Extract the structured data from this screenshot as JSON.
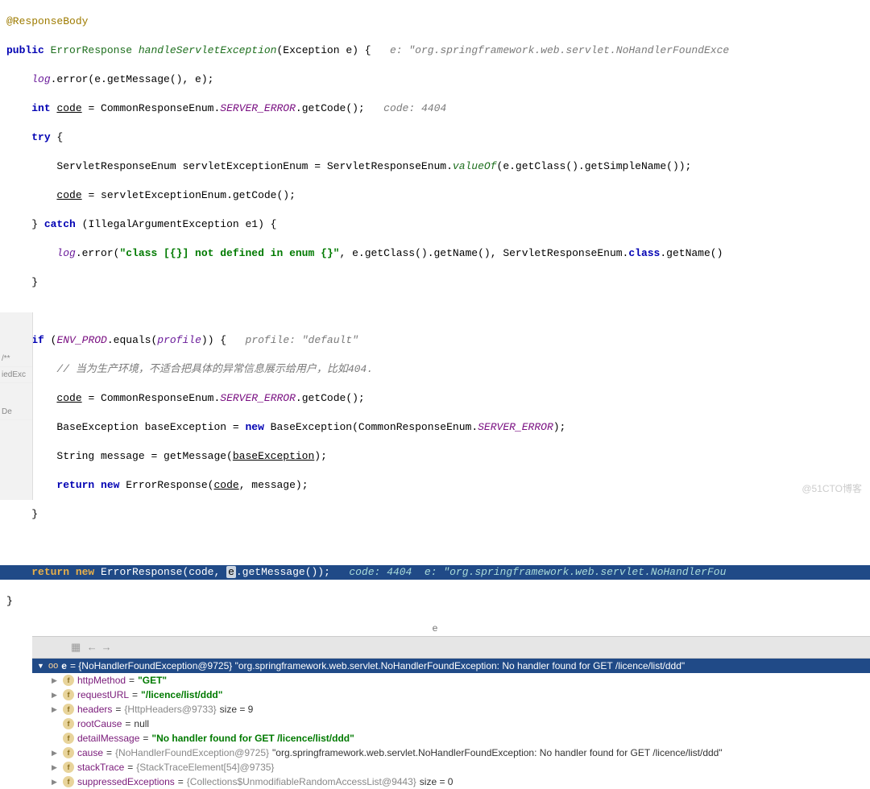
{
  "code": {
    "annotation": "@ResponseBody",
    "l1_public": "public",
    "l1_retType": "ErrorResponse",
    "l1_method": "handleServletException",
    "l1_params": "(Exception e) {",
    "l1_hint": "e: \"org.springframework.web.servlet.NoHandlerFoundExce",
    "l2a": "log",
    "l2b": ".error(e.getMessage(), e);",
    "l3a": "int",
    "l3b": "code",
    "l3c": " = CommonResponseEnum.",
    "l3d": "SERVER_ERROR",
    "l3e": ".getCode();",
    "l3hint": "code: 4404",
    "l4": "try",
    "l4b": " {",
    "l5a": "ServletResponseEnum servletExceptionEnum = ServletResponseEnum.",
    "l5b": "valueOf",
    "l5c": "(e.getClass().getSimpleName());",
    "l6a": "code",
    "l6b": " = servletExceptionEnum.getCode();",
    "l7a": "} ",
    "l7b": "catch",
    "l7c": " (IllegalArgumentException e1) {",
    "l8a": "log",
    "l8b": ".error(",
    "l8c": "\"class [{}] not defined in enum {}\"",
    "l8d": ", e.getClass().getName(), ServletResponseEnum.",
    "l8e": "class",
    "l8f": ".getName()",
    "l9": "}",
    "l11a": "if",
    "l11b": " (",
    "l11c": "ENV_PROD",
    "l11d": ".equals(",
    "l11e": "profile",
    "l11f": ")) {",
    "l11hint": "profile: \"default\"",
    "l12": "// 当为生产环境，不适合把具体的异常信息展示给用户，比如404.",
    "l13a": "code",
    "l13b": " = CommonResponseEnum.",
    "l13c": "SERVER_ERROR",
    "l13d": ".getCode();",
    "l14a": "BaseException baseException = ",
    "l14b": "new",
    "l14c": " BaseException(CommonResponseEnum.",
    "l14d": "SERVER_ERROR",
    "l14e": ");",
    "l15a": "String message = getMessage(",
    "l15b": "baseException",
    "l15c": ");",
    "l16a": "return new",
    "l16b": " ErrorResponse(",
    "l16c": "code",
    "l16d": ", message);",
    "l17": "}",
    "hl_a": "return new",
    "hl_b": " ErrorResponse(code, ",
    "hl_box": "e",
    "hl_c": ".getMessage());",
    "hl_hint": "code: 4404  e: \"org.springframework.web.servlet.NoHandlerFou",
    "close": "}",
    "caret_label": "e"
  },
  "left": {
    "m1": "/**",
    "m2": "iedExc",
    "m3": "De"
  },
  "debug": {
    "root_name": "e",
    "root_val": "= {NoHandlerFoundException@9725} \"org.springframework.web.servlet.NoHandlerFoundException: No handler found for GET /licence/list/ddd\"",
    "rows": [
      {
        "name": "httpMethod",
        "eq": " = ",
        "val": "\"GET\"",
        "cls": "val-str",
        "arrow": true
      },
      {
        "name": "requestURL",
        "eq": " = ",
        "val": "\"/licence/list/ddd\"",
        "cls": "val-str",
        "arrow": true
      },
      {
        "name": "headers",
        "eq": " = ",
        "gray": "{HttpHeaders@9733}",
        "tail": "  size = 9",
        "arrow": true
      },
      {
        "name": "rootCause",
        "eq": " = ",
        "val": "null",
        "cls": "val-plain",
        "arrow": false
      },
      {
        "name": "detailMessage",
        "eq": " = ",
        "val": "\"No handler found for GET /licence/list/ddd\"",
        "cls": "val-str",
        "arrow": false
      },
      {
        "name": "cause",
        "eq": " = ",
        "gray": "{NoHandlerFoundException@9725}",
        "tail": " \"org.springframework.web.servlet.NoHandlerFoundException: No handler found for GET /licence/list/ddd\"",
        "arrow": true
      },
      {
        "name": "stackTrace",
        "eq": " = ",
        "gray": "{StackTraceElement[54]@9735}",
        "tail": "",
        "arrow": true
      },
      {
        "name": "suppressedExceptions",
        "eq": " = ",
        "gray": "{Collections$UnmodifiableRandomAccessList@9443}",
        "tail": "  size = 0",
        "arrow": true
      }
    ]
  },
  "watermark": "@51CTO博客"
}
